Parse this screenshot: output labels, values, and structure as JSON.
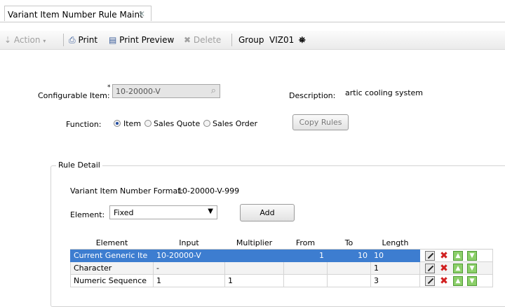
{
  "tab": {
    "title": "Variant Item Number Rule Maint",
    "close": "✕"
  },
  "toolbar": {
    "action": "Action",
    "print": "Print",
    "print_preview": "Print Preview",
    "delete": "Delete",
    "group_label": "Group",
    "group_value": "VIZ01"
  },
  "form": {
    "configurable_label": "Configurable Item:",
    "required_mark": "*",
    "configurable_value": "10-20000-V",
    "description_label": "Description:",
    "description_value": "artic cooling system",
    "function_label": "Function:",
    "opt_item": "Item",
    "opt_quote": "Sales Quote",
    "opt_order": "Sales Order",
    "selected_function": "Item",
    "copy_rules": "Copy Rules"
  },
  "rule_detail": {
    "title": "Rule Detail",
    "format_label": "Variant Item Number Format:",
    "format_value": "10-20000-V-999",
    "element_label": "Element:",
    "element_value": "Fixed",
    "add": "Add",
    "columns": [
      "Element",
      "Input",
      "Multiplier",
      "From",
      "To",
      "Length"
    ],
    "rows": [
      {
        "element": "Current Generic Ite",
        "input": "10-20000-V",
        "multiplier": "",
        "from": "1",
        "to": "10",
        "length": "10",
        "selected": true
      },
      {
        "element": "Character",
        "input": "-",
        "multiplier": "",
        "from": "",
        "to": "",
        "length": "1",
        "selected": false
      },
      {
        "element": "Numeric Sequence",
        "input": "1",
        "multiplier": "1",
        "from": "",
        "to": "",
        "length": "3",
        "selected": false
      }
    ]
  }
}
